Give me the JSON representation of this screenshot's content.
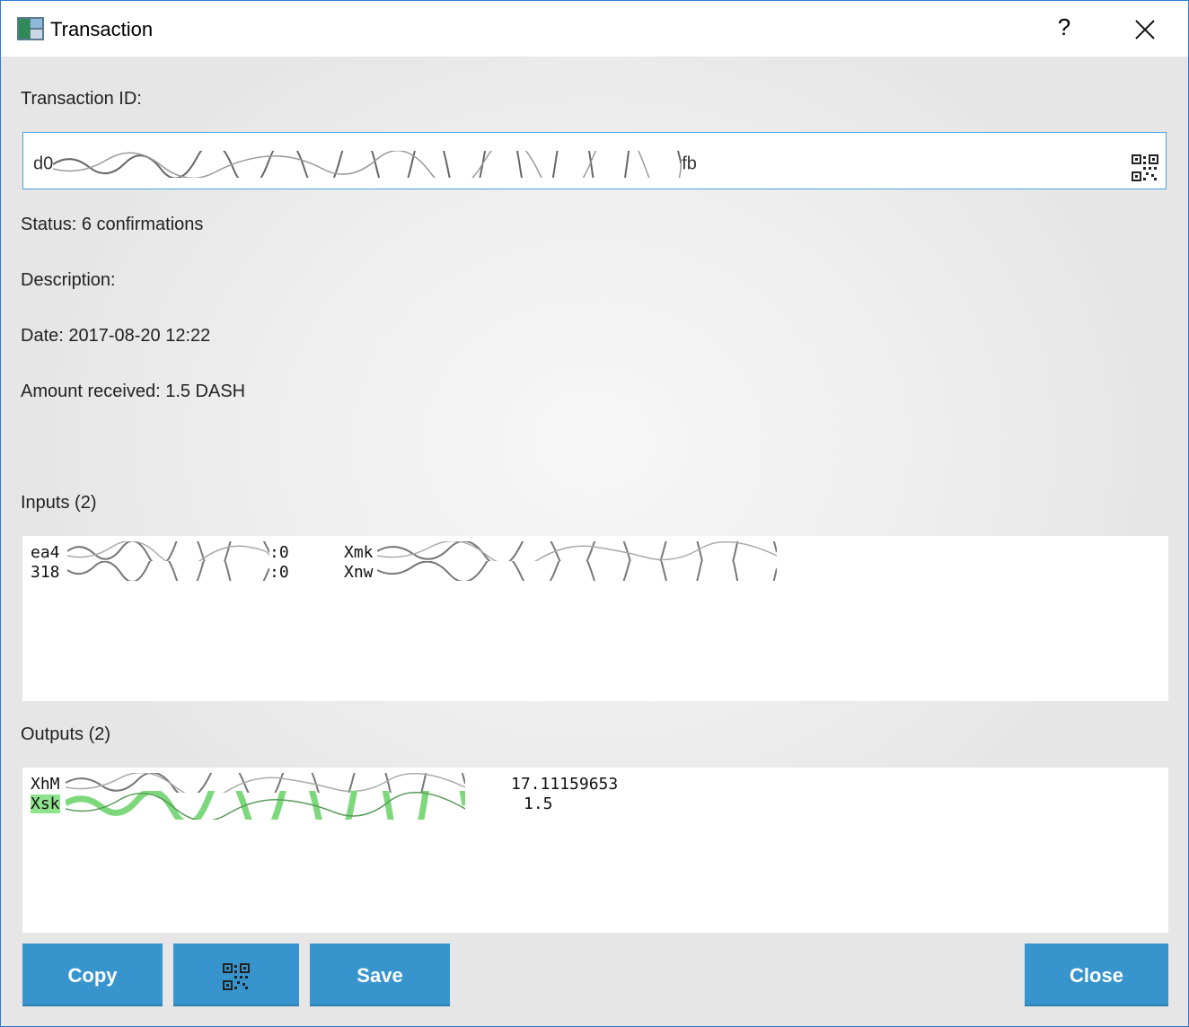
{
  "window": {
    "title": "Transaction",
    "help_glyph": "?",
    "close_glyph": "close"
  },
  "txid": {
    "label": "Transaction ID:",
    "prefix": "d0",
    "suffix": "fb",
    "qr_icon": "qr-code-icon"
  },
  "details": {
    "status": "Status: 6 confirmations",
    "description": "Description:",
    "date": "Date: 2017-08-20 12:22",
    "amount": "Amount received: 1.5 DASH"
  },
  "inputs": {
    "label": "Inputs (2)",
    "rows": [
      {
        "tx_prefix": "ea4",
        "index": ":0",
        "addr_prefix": "Xmk"
      },
      {
        "tx_prefix": "318",
        "index": ":0",
        "addr_prefix": "Xnw"
      }
    ]
  },
  "outputs": {
    "label": "Outputs (2)",
    "rows": [
      {
        "addr_prefix": "XhM",
        "amount": "17.11159653",
        "highlighted": false
      },
      {
        "addr_prefix": "Xsk",
        "amount": "1.5",
        "highlighted": true
      }
    ],
    "highlight_color": "#8fe38f"
  },
  "buttons": {
    "copy": "Copy",
    "qr_icon": "qr-code-icon",
    "save": "Save",
    "close": "Close"
  },
  "colors": {
    "accent": "#3794cc",
    "focus_border": "#4aa3df"
  }
}
